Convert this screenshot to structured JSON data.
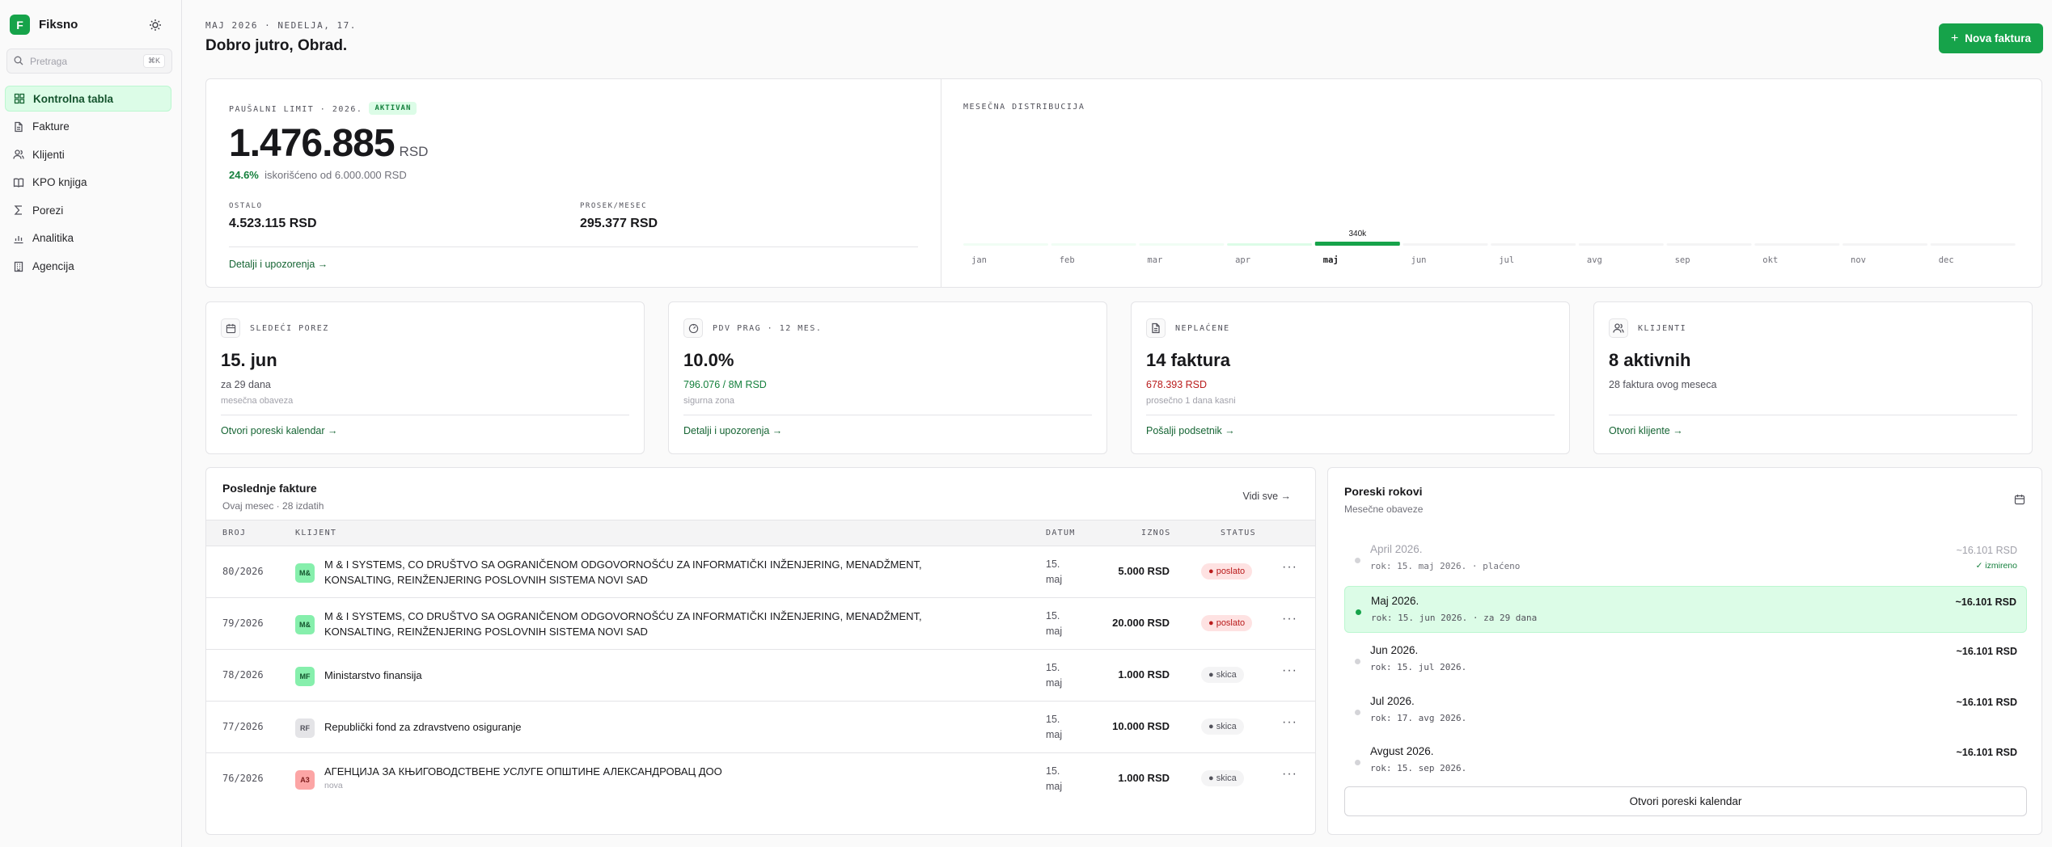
{
  "sidebar": {
    "logo_letter": "F",
    "brand": "Fiksno",
    "search_placeholder": "Pretraga",
    "search_kbd": "⌘K",
    "items": [
      {
        "label": "Kontrolna tabla",
        "icon": "dashboard-icon",
        "active": true
      },
      {
        "label": "Fakture",
        "icon": "document-icon"
      },
      {
        "label": "Klijenti",
        "icon": "users-icon"
      },
      {
        "label": "KPO knjiga",
        "icon": "book-icon"
      },
      {
        "label": "Porezi",
        "icon": "sigma-icon"
      },
      {
        "label": "Analitika",
        "icon": "bar-chart-icon"
      },
      {
        "label": "Agencija",
        "icon": "building-icon"
      }
    ]
  },
  "header": {
    "date": "MAJ 2026 · NEDELJA, 17.",
    "greeting": "Dobro jutro, Obrad.",
    "new_invoice": "Nova faktura"
  },
  "limit": {
    "label": "PAUŠALNI LIMIT · 2026.",
    "badge": "AKTIVAN",
    "amount": "1.476.885",
    "currency": "RSD",
    "percent": "24.6%",
    "usage_text": "iskorišćeno od 6.000.000 RSD",
    "remaining_label": "OSTALO",
    "remaining_value": "4.523.115 RSD",
    "avg_label": "PROSEK/MESEC",
    "avg_value": "295.377 RSD",
    "link": "Detalji i upozorenja →"
  },
  "chart_data": {
    "type": "bar",
    "title": "MESEČNA DISTRIBUCIJA",
    "categories": [
      "jan",
      "feb",
      "mar",
      "apr",
      "maj",
      "jun",
      "jul",
      "avg",
      "sep",
      "okt",
      "nov",
      "dec"
    ],
    "values": [
      0,
      0,
      0,
      0,
      340000,
      0,
      0,
      0,
      0,
      0,
      0,
      0
    ],
    "data_labels": [
      "",
      "",
      "",
      "",
      "340k",
      "",
      "",
      "",
      "",
      "",
      "",
      ""
    ],
    "current_index": 4,
    "colors": {
      "current": "#16a34a",
      "past": "#dcfce7",
      "future": "#f4f4f5"
    }
  },
  "cards": [
    {
      "icon": "calendar-icon",
      "label": "SLEDEĆI POREZ",
      "value": "15. jun",
      "sub": "za 29 dana",
      "sub_color": "#52525b",
      "sub2": "mesečna obaveza",
      "link": "Otvori poreski kalendar →"
    },
    {
      "icon": "gauge-icon",
      "label": "PDV PRAG · 12 MES.",
      "value": "10.0%",
      "sub": "796.076 / 8M RSD",
      "sub_color": "#15803d",
      "sub2": "sigurna zona",
      "link": "Detalji i upozorenja →"
    },
    {
      "icon": "document-icon",
      "label": "NEPLAĆENE",
      "value": "14 faktura",
      "sub": "678.393 RSD",
      "sub_color": "#b91c1c",
      "sub2": "prosečno 1 dana kasni",
      "link": "Pošalji podsetnik →"
    },
    {
      "icon": "users-icon",
      "label": "KLIJENTI",
      "value": "8 aktivnih",
      "sub": "28 faktura ovog meseca",
      "sub_color": "#52525b",
      "sub2": "",
      "link": "Otvori klijente →"
    }
  ],
  "invoices": {
    "title": "Poslednje fakture",
    "subtitle": "Ovaj mesec · 28 izdatih",
    "see_all": "Vidi sve →",
    "headers": {
      "no": "BROJ",
      "client": "KLIJENT",
      "date": "DATUM",
      "amount": "IZNOS",
      "status": "STATUS"
    },
    "rows": [
      {
        "no": "80/2026",
        "initials": "M&",
        "av": "g",
        "client": "M & I SYSTEMS, CO DRUŠTVO SA OGRANIČENOM ODGOVORNOŠĆU ZA INFORMATIČKI INŽENJERING, MENADŽMENT, KONSALTING, REINŽENJERING POSLOVNIH SISTEMA NOVI SAD",
        "sub": "",
        "date": "15. maj",
        "amount": "5.000 RSD",
        "status": "● poslato",
        "st": "sent"
      },
      {
        "no": "79/2026",
        "initials": "M&",
        "av": "g",
        "client": "M & I SYSTEMS, CO DRUŠTVO SA OGRANIČENOM ODGOVORNOŠĆU ZA INFORMATIČKI INŽENJERING, MENADŽMENT, KONSALTING, REINŽENJERING POSLOVNIH SISTEMA NOVI SAD",
        "sub": "",
        "date": "15. maj",
        "amount": "20.000 RSD",
        "status": "● poslato",
        "st": "sent"
      },
      {
        "no": "78/2026",
        "initials": "MF",
        "av": "g",
        "client": "Ministarstvo finansija",
        "sub": "",
        "date": "15. maj",
        "amount": "1.000 RSD",
        "status": "● skica",
        "st": "draft"
      },
      {
        "no": "77/2026",
        "initials": "RF",
        "av": "gr",
        "client": "Republički fond za zdravstveno osiguranje",
        "sub": "",
        "date": "15. maj",
        "amount": "10.000 RSD",
        "status": "● skica",
        "st": "draft"
      },
      {
        "no": "76/2026",
        "initials": "A3",
        "av": "r",
        "client": "АГЕНЦИЈА ЗА КЊИГОВОДСТВЕНЕ УСЛУГЕ ОПШТИНЕ АЛЕКСАНДРОВАЦ ДОО",
        "sub": "nova",
        "date": "15. maj",
        "amount": "1.000 RSD",
        "status": "● skica",
        "st": "draft"
      }
    ]
  },
  "tax": {
    "title": "Poreski rokovi",
    "subtitle": "Mesečne obaveze",
    "items": [
      {
        "month": "April 2026.",
        "due": "rok: 15. maj 2026. · plaćeno",
        "amount": "~16.101 RSD",
        "paid": "✓ izmireno",
        "state": "past"
      },
      {
        "month": "Maj 2026.",
        "due": "rok: 15. jun 2026. · za 29 dana",
        "amount": "~16.101 RSD",
        "paid": "",
        "state": "current"
      },
      {
        "month": "Jun 2026.",
        "due": "rok: 15. jul 2026.",
        "amount": "~16.101 RSD",
        "paid": "",
        "state": "future"
      },
      {
        "month": "Jul 2026.",
        "due": "rok: 17. avg 2026.",
        "amount": "~16.101 RSD",
        "paid": "",
        "state": "future"
      },
      {
        "month": "Avgust 2026.",
        "due": "rok: 15. sep 2026.",
        "amount": "~16.101 RSD",
        "paid": "",
        "state": "future"
      }
    ],
    "button": "Otvori poreski kalendar"
  }
}
